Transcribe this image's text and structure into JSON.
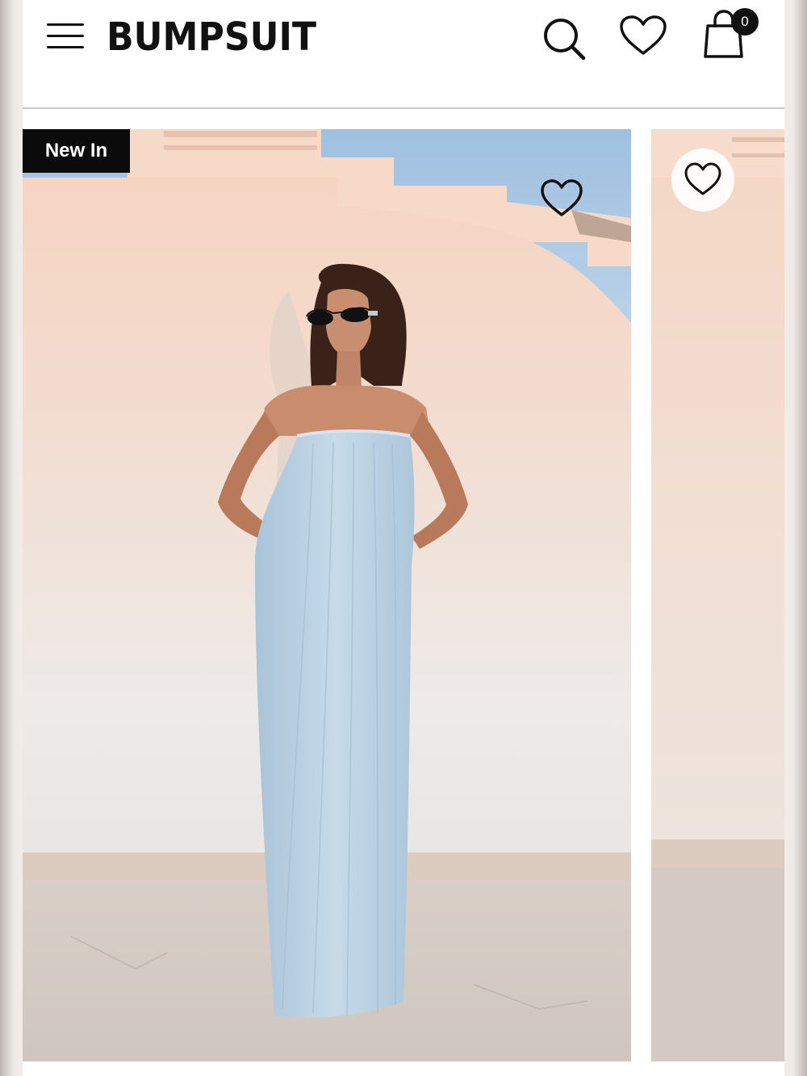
{
  "header": {
    "logo": "BUMPSUIT",
    "cart_count": "0"
  },
  "icons": {
    "menu": "hamburger-icon",
    "search": "search-icon",
    "wishlist": "heart-icon",
    "cart": "shopping-bag-icon"
  },
  "products": [
    {
      "badge": "New In",
      "image": "model in strapless pale blue maxi dress against white wall"
    },
    {
      "image": "partially visible next product"
    }
  ],
  "colors": {
    "ink": "#111111",
    "badge_bg": "#0b0b0b",
    "dress_blue": "#bcd3e4",
    "wall": "#f1e4dc",
    "sky": "#a8c7e3"
  }
}
